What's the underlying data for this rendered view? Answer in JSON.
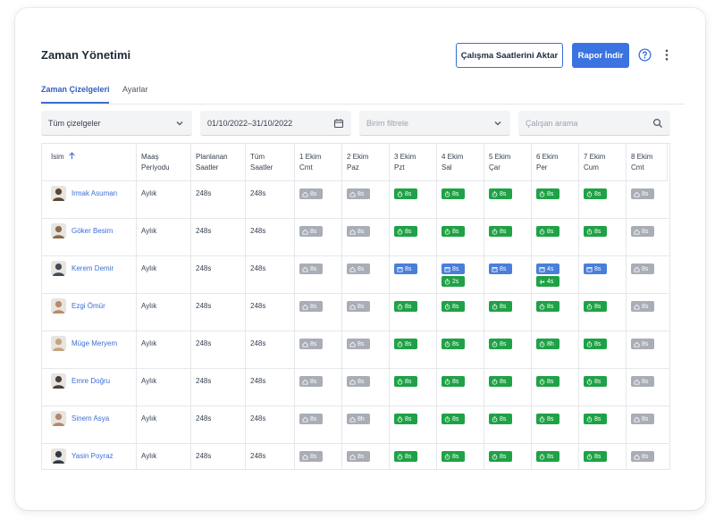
{
  "header": {
    "title": "Zaman Yönetimi",
    "transfer_button": "Çalışma Saatlerini Aktar",
    "report_button": "Rapor İndir"
  },
  "tabs": [
    {
      "label": "Zaman Çizelgeleri",
      "active": true
    },
    {
      "label": "Ayarlar",
      "active": false
    }
  ],
  "filters": {
    "timesheets_select": "Tüm çizelgeler",
    "date_range": "01/10/2022–31/10/2022",
    "unit_placeholder": "Birim filtrele",
    "search_placeholder": "Çalışan arama"
  },
  "table": {
    "columns": [
      {
        "line1": "İsim",
        "line2": ""
      },
      {
        "line1": "Maaş",
        "line2": "Periyodu"
      },
      {
        "line1": "Planlanan",
        "line2": "Saatler"
      },
      {
        "line1": "Tüm",
        "line2": "Saatler"
      },
      {
        "line1": "1 Ekim",
        "line2": "Cmt"
      },
      {
        "line1": "2 Ekim",
        "line2": "Paz"
      },
      {
        "line1": "3 Ekim",
        "line2": "Pzt"
      },
      {
        "line1": "4 Ekim",
        "line2": "Sal"
      },
      {
        "line1": "5 Ekim",
        "line2": "Çar"
      },
      {
        "line1": "6 Ekim",
        "line2": "Per"
      },
      {
        "line1": "7 Ekim",
        "line2": "Cum"
      },
      {
        "line1": "8 Ekim",
        "line2": "Cmt"
      }
    ],
    "rows": [
      {
        "name": "Irmak Asuman",
        "period": "Aylık",
        "planned": "248s",
        "total": "248s",
        "days": [
          [
            {
              "t": "home",
              "v": "8s"
            }
          ],
          [
            {
              "t": "home",
              "v": "8s"
            }
          ],
          [
            {
              "t": "clock",
              "v": "8s"
            }
          ],
          [
            {
              "t": "clock",
              "v": "8s"
            }
          ],
          [
            {
              "t": "clock",
              "v": "8s"
            }
          ],
          [
            {
              "t": "clock",
              "v": "8s"
            }
          ],
          [
            {
              "t": "clock",
              "v": "8s"
            }
          ],
          [
            {
              "t": "home",
              "v": "8s"
            }
          ]
        ]
      },
      {
        "name": "Göker Besim",
        "period": "Aylık",
        "planned": "248s",
        "total": "248s",
        "days": [
          [
            {
              "t": "home",
              "v": "8s"
            }
          ],
          [
            {
              "t": "home",
              "v": "8s"
            }
          ],
          [
            {
              "t": "clock",
              "v": "8s"
            }
          ],
          [
            {
              "t": "clock",
              "v": "8s"
            }
          ],
          [
            {
              "t": "clock",
              "v": "8s"
            }
          ],
          [
            {
              "t": "clock",
              "v": "8s"
            }
          ],
          [
            {
              "t": "clock",
              "v": "8s"
            }
          ],
          [
            {
              "t": "home",
              "v": "8s"
            }
          ]
        ]
      },
      {
        "name": "Kerem Demir",
        "period": "Aylık",
        "planned": "248s",
        "total": "248s",
        "days": [
          [
            {
              "t": "home",
              "v": "8s"
            }
          ],
          [
            {
              "t": "home",
              "v": "8s"
            }
          ],
          [
            {
              "t": "cal",
              "v": "8s"
            }
          ],
          [
            {
              "t": "cal",
              "v": "8s"
            },
            {
              "t": "clock",
              "v": "2s"
            }
          ],
          [
            {
              "t": "cal",
              "v": "8s"
            }
          ],
          [
            {
              "t": "cal",
              "v": "4s"
            },
            {
              "t": "plane",
              "v": "4s"
            }
          ],
          [
            {
              "t": "cal",
              "v": "8s"
            }
          ],
          [
            {
              "t": "home",
              "v": "8s"
            }
          ]
        ]
      },
      {
        "name": "Ezgi Ömür",
        "period": "Aylık",
        "planned": "248s",
        "total": "248s",
        "days": [
          [
            {
              "t": "home",
              "v": "8s"
            }
          ],
          [
            {
              "t": "home",
              "v": "8s"
            }
          ],
          [
            {
              "t": "clock",
              "v": "8s"
            }
          ],
          [
            {
              "t": "clock",
              "v": "8s"
            }
          ],
          [
            {
              "t": "clock",
              "v": "8s"
            }
          ],
          [
            {
              "t": "clock",
              "v": "8s"
            }
          ],
          [
            {
              "t": "clock",
              "v": "8s"
            }
          ],
          [
            {
              "t": "home",
              "v": "8s"
            }
          ]
        ]
      },
      {
        "name": "Müge Meryem",
        "period": "Aylık",
        "planned": "248s",
        "total": "248s",
        "days": [
          [
            {
              "t": "home",
              "v": "8s"
            }
          ],
          [
            {
              "t": "home",
              "v": "8s"
            }
          ],
          [
            {
              "t": "clock",
              "v": "8s"
            }
          ],
          [
            {
              "t": "clock",
              "v": "8s"
            }
          ],
          [
            {
              "t": "clock",
              "v": "8s"
            }
          ],
          [
            {
              "t": "clock",
              "v": "8h"
            }
          ],
          [
            {
              "t": "clock",
              "v": "8s"
            }
          ],
          [
            {
              "t": "home",
              "v": "8s"
            }
          ]
        ]
      },
      {
        "name": "Emre Doğru",
        "period": "Aylık",
        "planned": "248s",
        "total": "248s",
        "days": [
          [
            {
              "t": "home",
              "v": "8s"
            }
          ],
          [
            {
              "t": "home",
              "v": "8s"
            }
          ],
          [
            {
              "t": "clock",
              "v": "8s"
            }
          ],
          [
            {
              "t": "clock",
              "v": "8s"
            }
          ],
          [
            {
              "t": "clock",
              "v": "8s"
            }
          ],
          [
            {
              "t": "clock",
              "v": "8s"
            }
          ],
          [
            {
              "t": "clock",
              "v": "8s"
            }
          ],
          [
            {
              "t": "home",
              "v": "8s"
            }
          ]
        ]
      },
      {
        "name": "Sinem Asya",
        "period": "Aylık",
        "planned": "248s",
        "total": "248s",
        "days": [
          [
            {
              "t": "home",
              "v": "8s"
            }
          ],
          [
            {
              "t": "home",
              "v": "8h"
            }
          ],
          [
            {
              "t": "clock",
              "v": "8s"
            }
          ],
          [
            {
              "t": "clock",
              "v": "8s"
            }
          ],
          [
            {
              "t": "clock",
              "v": "8s"
            }
          ],
          [
            {
              "t": "clock",
              "v": "8s"
            }
          ],
          [
            {
              "t": "clock",
              "v": "8s"
            }
          ],
          [
            {
              "t": "home",
              "v": "8s"
            }
          ]
        ]
      },
      {
        "name": "Yasin Poyraz",
        "period": "Aylık",
        "planned": "248s",
        "total": "248s",
        "days": [
          [
            {
              "t": "home",
              "v": "8s"
            }
          ],
          [
            {
              "t": "home",
              "v": "8s"
            }
          ],
          [
            {
              "t": "clock",
              "v": "8s"
            }
          ],
          [
            {
              "t": "clock",
              "v": "8s"
            }
          ],
          [
            {
              "t": "clock",
              "v": "8s"
            }
          ],
          [
            {
              "t": "clock",
              "v": "8s"
            }
          ],
          [
            {
              "t": "clock",
              "v": "8s"
            }
          ],
          [
            {
              "t": "home",
              "v": "8s"
            }
          ]
        ]
      }
    ]
  },
  "colors": {
    "accent": "#3b73e0",
    "link": "#3b6fd6",
    "badge_home": "#a8adb6",
    "badge_work": "#1fa246",
    "badge_plan": "#4a7fd9"
  },
  "icons": {
    "home": "home-icon",
    "clock": "stopwatch-icon",
    "cal": "calendar-icon",
    "plane": "plane-icon"
  }
}
